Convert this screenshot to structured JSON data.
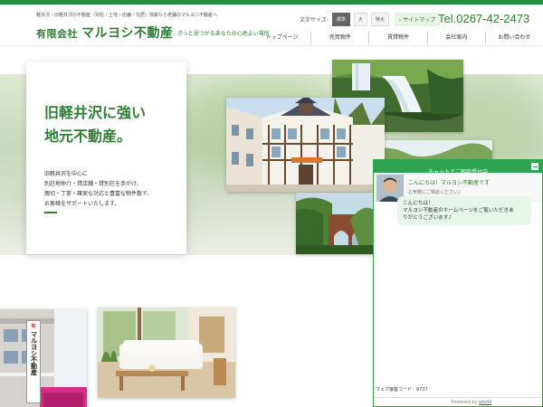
{
  "header": {
    "tagline": "軽井沢・旧軽井沢の不動産（別荘・土地・店舗・住居）情報なら老舗のマルヨシ不動産へ",
    "logo_prefix": "有限会社",
    "logo_name": "マルヨシ不動産",
    "catchphrase": "きっと見つかるあなたの心地よい場所",
    "font_size_label": "文字サイズ:",
    "font_sizes": [
      "標準",
      "大",
      "特大"
    ],
    "font_size_active": "標準",
    "sitemap_label": "サイトマップ",
    "phone": "Tel.0267-42-2473"
  },
  "nav": {
    "items": [
      "トップページ",
      "売買物件",
      "賃貸物件",
      "会社案内",
      "お問い合わせ"
    ]
  },
  "intro": {
    "headline_line1": "旧軽井沢に強い",
    "headline_line2": "地元不動産。",
    "body": [
      "旧軽井沢を中心に",
      "別荘地仲介・貸店舗・貸別荘を手がけ、",
      "親切・丁寧・確実な対応と豊富な物件数で、",
      "お客様をサポートいたします。"
    ]
  },
  "photos": {
    "sign_text": "マルヨシ不動産",
    "sign_prefix": "有"
  },
  "chat": {
    "header": "チャットでご相談受付中",
    "operator_name": "こんにちは！マルヨシ不動産です",
    "operator_sub": "お気軽にご相談ください♪",
    "message_lines": [
      "こんにちは！",
      "マルヨシ不動産のホームページをご覧いただきあ",
      "りがとうございます♪"
    ],
    "web_code": "ウェブ接客コード：9737",
    "powered_by_prefix": "Powered by",
    "powered_by_brand": "sincl∂"
  },
  "colors": {
    "brand_green": "#2e7d32",
    "chat_green": "#2ea44f"
  }
}
